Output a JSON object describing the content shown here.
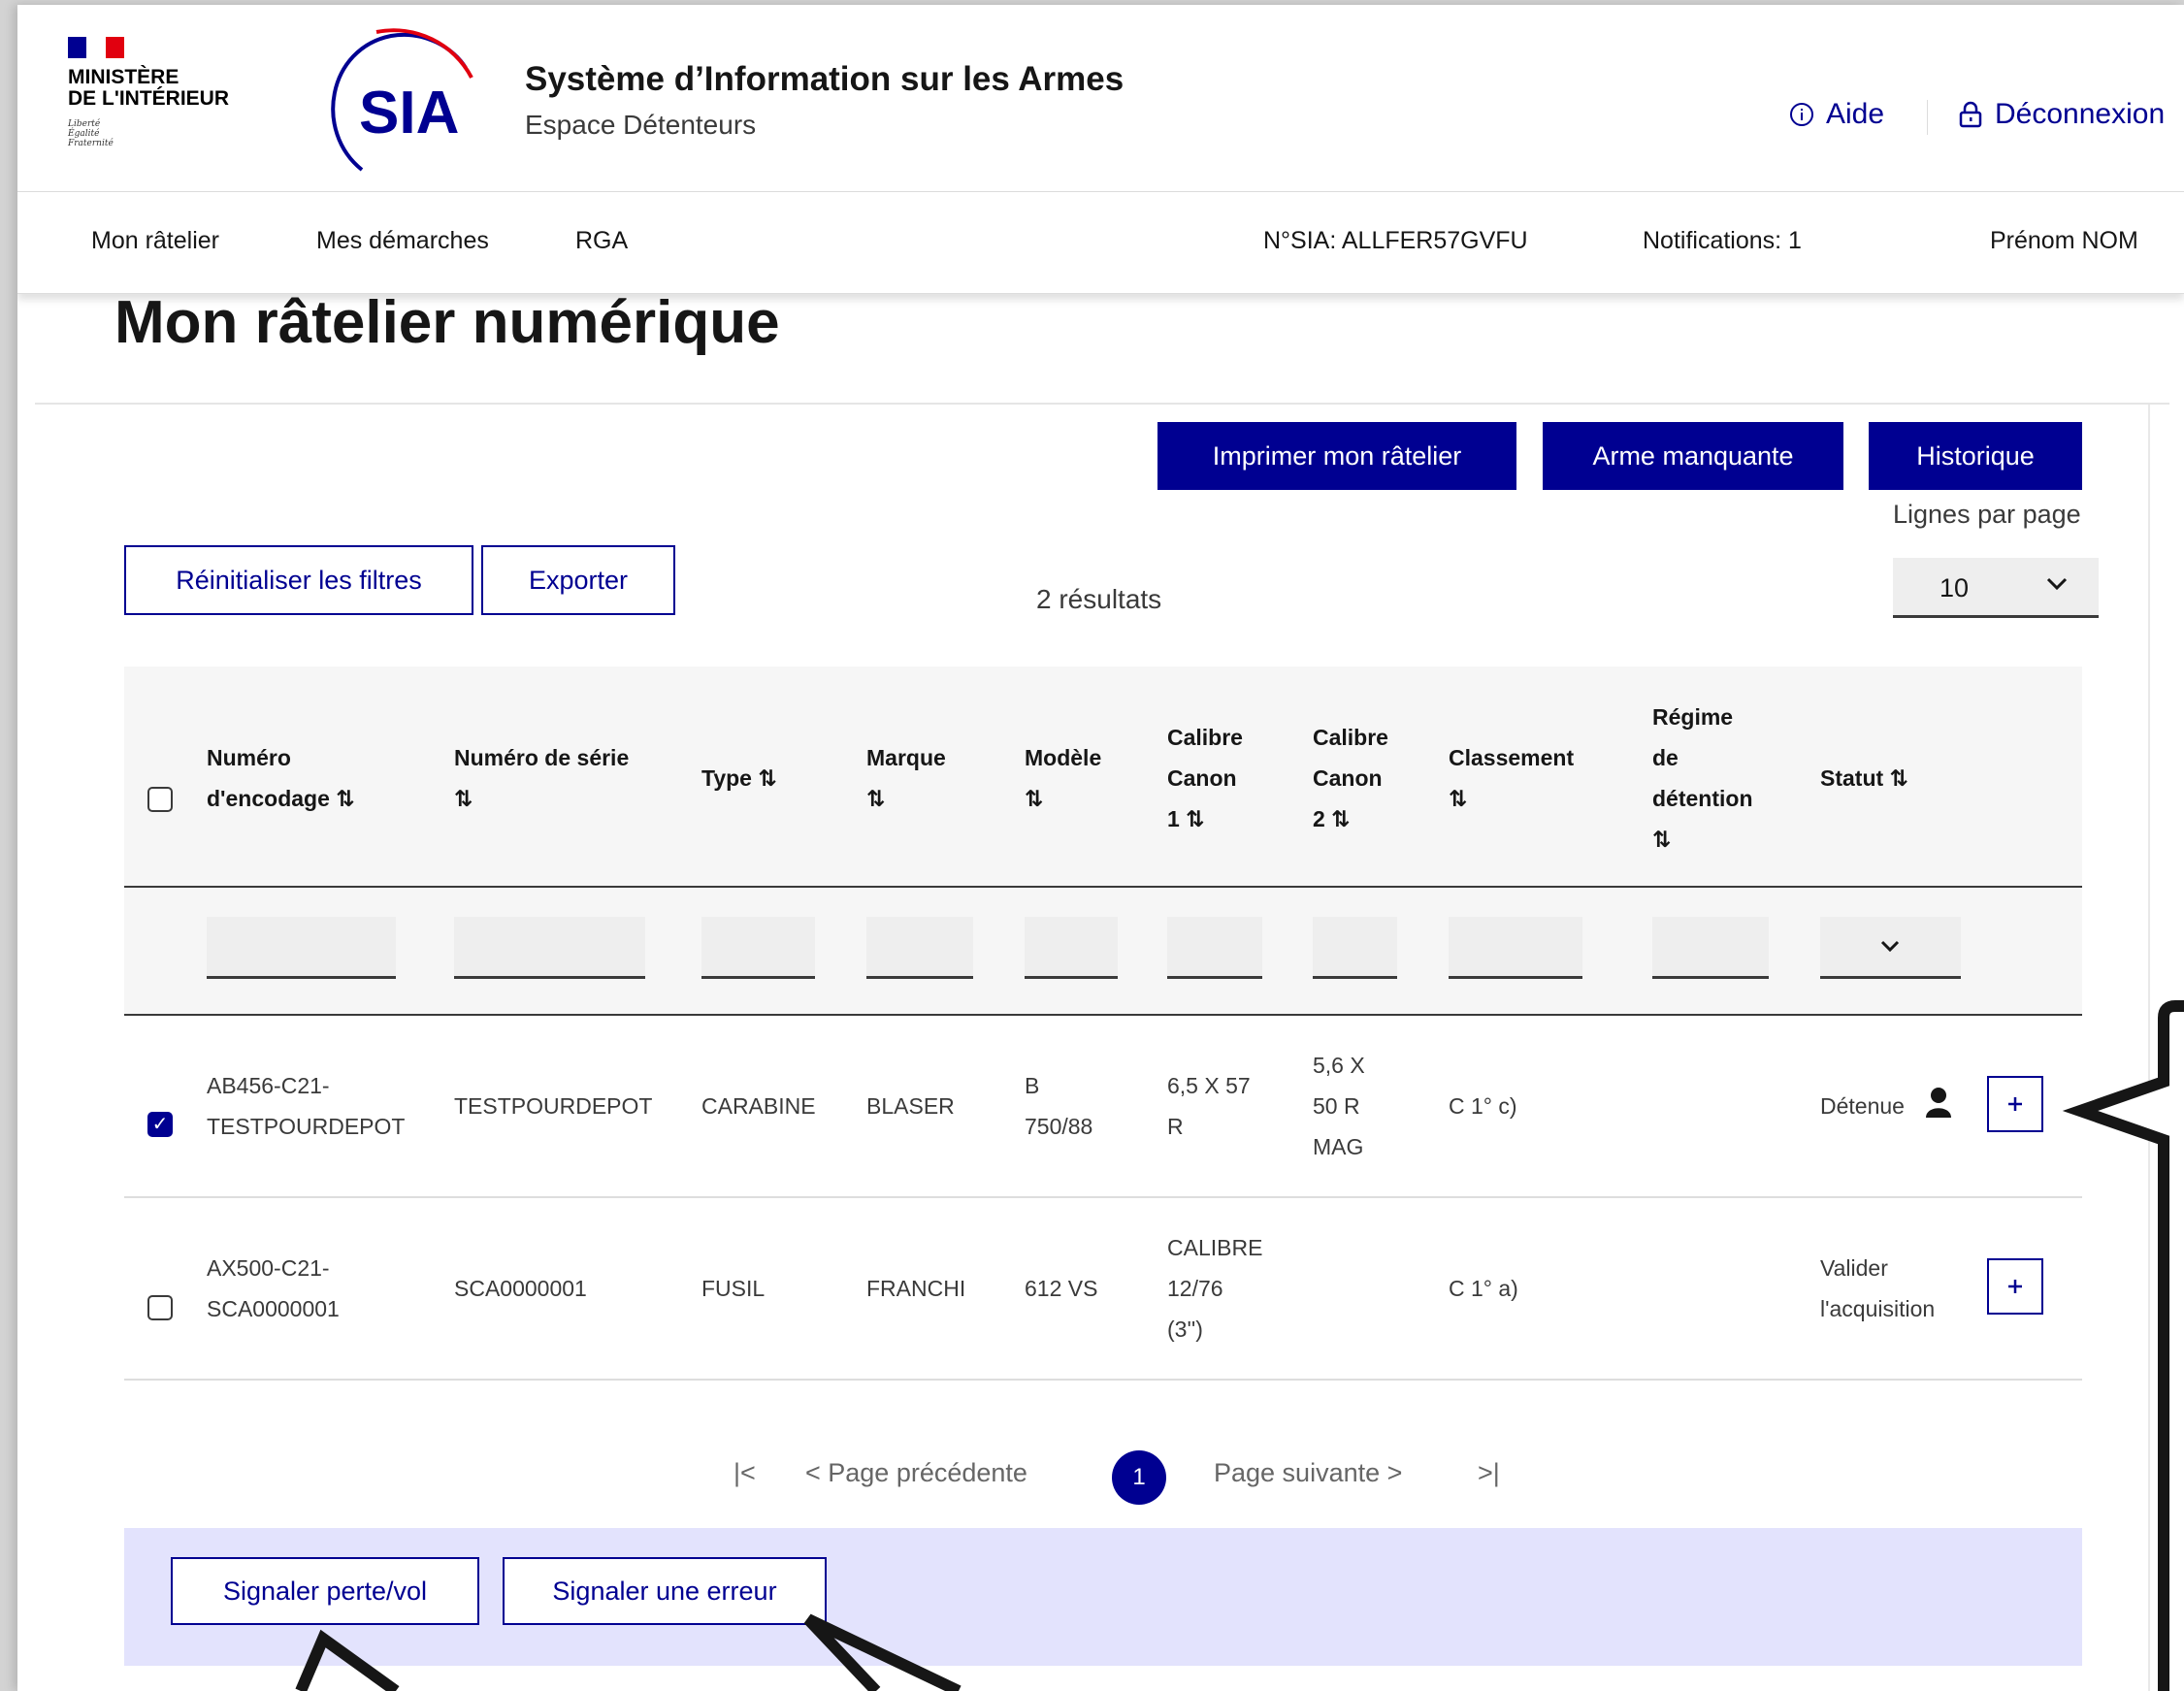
{
  "header": {
    "ministry": "MINISTÈRE\nDE L'INTÉRIEUR",
    "devise": "Liberté\nÉgalité\nFraternité",
    "logo_text": "SIA",
    "site_title": "Système d’Information sur les Armes",
    "site_subtitle": "Espace Détenteurs",
    "help_label": "Aide",
    "logout_label": "Déconnexion"
  },
  "nav": {
    "items": [
      "Mon râtelier",
      "Mes démarches",
      "RGA"
    ],
    "sia_number": "N°SIA: ALLFER57GVFU",
    "notifications": "Notifications: 1",
    "user": "Prénom NOM"
  },
  "page": {
    "title": "Mon râtelier numérique"
  },
  "actions": {
    "print": "Imprimer mon râtelier",
    "missing": "Arme manquante",
    "history": "Historique",
    "reset_filters": "Réinitialiser les filtres",
    "export": "Exporter",
    "results": "2 résultats",
    "lines_per_page_label": "Lignes par page",
    "lines_per_page_value": "10"
  },
  "table": {
    "headers": [
      "Numéro\nd'encodage ⇅",
      "Numéro de série\n⇅",
      "Type ⇅",
      "Marque\n⇅",
      "Modèle\n⇅",
      "Calibre\nCanon\n1 ⇅",
      "Calibre\nCanon\n2 ⇅",
      "Classement\n⇅",
      "Régime\nde\ndétention\n⇅",
      "Statut ⇅"
    ],
    "rows": [
      {
        "checked": true,
        "encodage": "AB456-C21-\nTESTPOURDEPOT",
        "serie": "TESTPOURDEPOT",
        "type": "CARABINE",
        "marque": "BLASER",
        "modele": "B\n750/88",
        "calibre1": "6,5 X 57\nR",
        "calibre2": "5,6 X\n50 R\nMAG",
        "classement": "C 1° c)",
        "regime": "",
        "statut": "Détenue"
      },
      {
        "checked": false,
        "encodage": "AX500-C21-\nSCA0000001",
        "serie": "SCA0000001",
        "type": "FUSIL",
        "marque": "FRANCHI",
        "modele": "612 VS",
        "calibre1": "CALIBRE\n12/76\n(3'')",
        "calibre2": "",
        "classement": "C 1° a)",
        "regime": "",
        "statut": "Valider\nl'acquisition"
      }
    ]
  },
  "pagination": {
    "first": "|<",
    "prev": "< Page précédente",
    "current": "1",
    "next": "Page suivante >",
    "last": ">|"
  },
  "bottom_actions": {
    "report_loss": "Signaler perte/vol",
    "report_error": "Signaler une erreur"
  },
  "colors": {
    "primary": "#000091",
    "flag_blue": "#000091",
    "flag_red": "#e1000f",
    "sia_red": "#e1000f",
    "bottom_bar": "#e3e3fd"
  }
}
